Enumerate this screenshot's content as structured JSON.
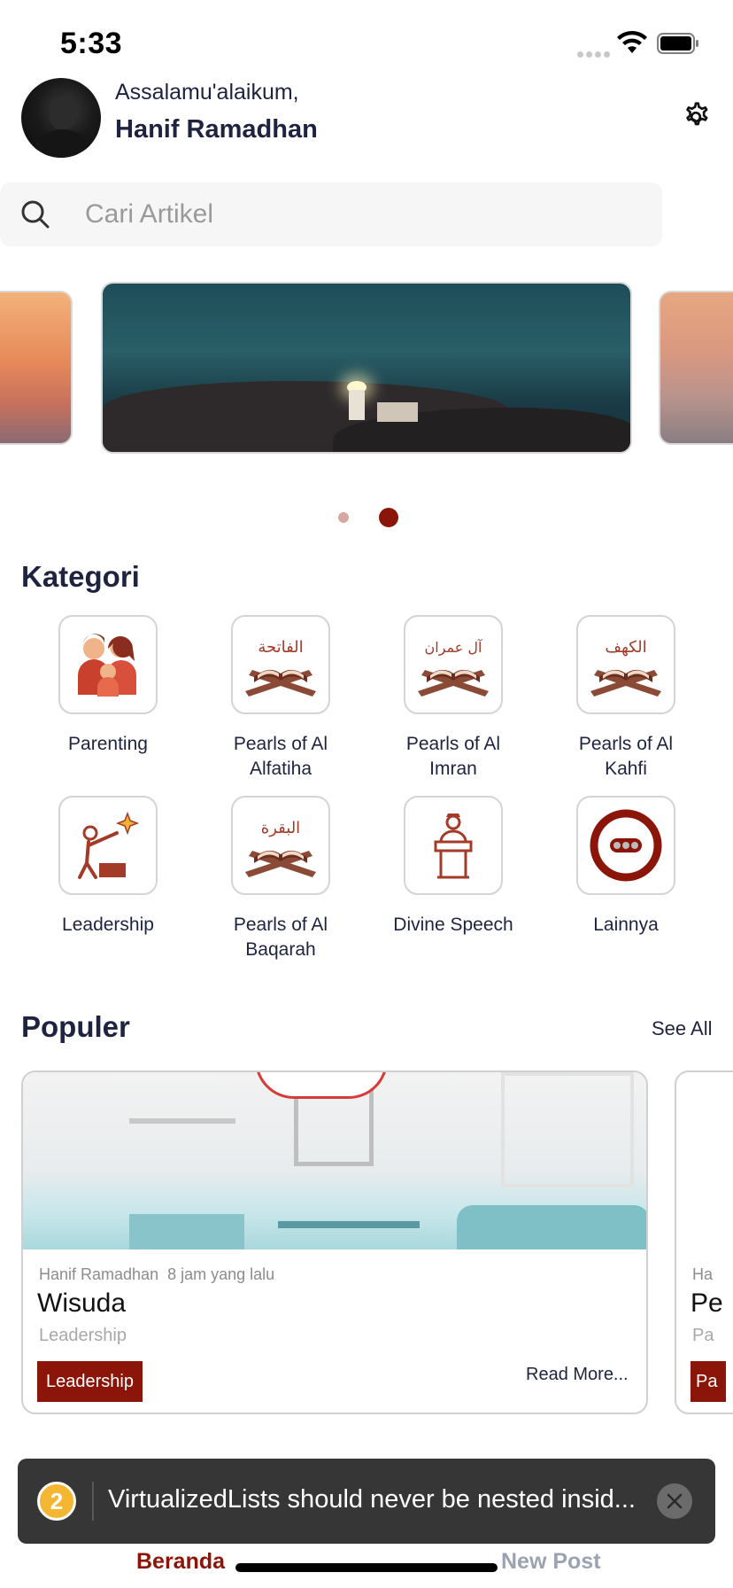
{
  "status_bar": {
    "time": "5:33"
  },
  "header": {
    "greeting": "Assalamu'alaikum,",
    "username": "Hanif Ramadhan"
  },
  "search": {
    "placeholder": "Cari Artikel"
  },
  "carousel": {
    "slide_count": 2,
    "active_index": 1
  },
  "kategori": {
    "title": "Kategori",
    "items": [
      {
        "label": "Parenting",
        "icon": "family-icon"
      },
      {
        "label": "Pearls of Al Alfatiha",
        "icon": "quran-alfatiha-icon",
        "arabic": "الفاتحة"
      },
      {
        "label": "Pearls of Al Imran",
        "icon": "quran-imran-icon",
        "arabic": "آل عمران"
      },
      {
        "label": "Pearls of Al Kahfi",
        "icon": "quran-kahfi-icon",
        "arabic": "الكهف"
      },
      {
        "label": "Leadership",
        "icon": "leadership-icon"
      },
      {
        "label": "Pearls of Al Baqarah",
        "icon": "quran-baqarah-icon",
        "arabic": "البقرة"
      },
      {
        "label": "Divine Speech",
        "icon": "podium-speaker-icon"
      },
      {
        "label": "Lainnya",
        "icon": "more-icon"
      }
    ]
  },
  "populer": {
    "title": "Populer",
    "see_all": "See All",
    "cards": [
      {
        "author": "Hanif Ramadhan",
        "time": "8 jam yang lalu",
        "title": "Wisuda",
        "subtitle": "Leadership",
        "tag": "Leadership",
        "read_more": "Read More..."
      },
      {
        "author": "Ha",
        "title": "Pe",
        "subtitle": "Pa",
        "tag": "Pa"
      }
    ]
  },
  "toast": {
    "count": "2",
    "message": "VirtualizedLists should never be nested insid..."
  },
  "bottom_nav": {
    "home": "Beranda",
    "new_post": "New Post"
  },
  "colors": {
    "accent": "#8b1508",
    "text": "#1e2340",
    "toast_bg": "#363636",
    "badge": "#f5b731"
  }
}
